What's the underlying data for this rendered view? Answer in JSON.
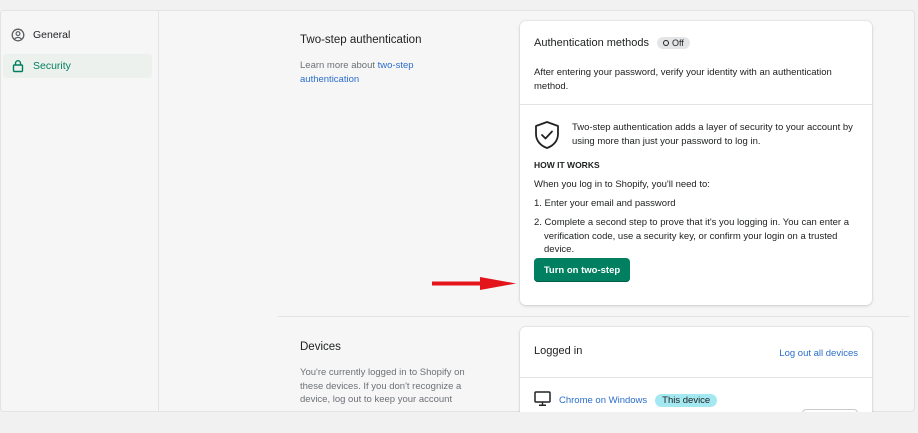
{
  "sidebar": {
    "items": [
      {
        "label": "General",
        "icon": "user-circle-icon"
      },
      {
        "label": "Security",
        "icon": "lock-icon"
      }
    ]
  },
  "two_step": {
    "title": "Two-step authentication",
    "desc_prefix": "Learn more about ",
    "desc_link": "two-step authentication"
  },
  "auth_card": {
    "title": "Authentication methods",
    "status_badge": "Off",
    "intro": "After entering your password, verify your identity with an authentication method.",
    "shield_text": "Two-step authentication adds a layer of security to your account by using more than just your password to log in.",
    "how_heading": "HOW IT WORKS",
    "how_intro": "When you log in to Shopify, you'll need to:",
    "step1": "1.  Enter your email and password",
    "step2": "2.  Complete a second step to prove that it's you logging in. You can enter a verification code, use a security key, or confirm your login on a trusted device.",
    "button": "Turn on two-step"
  },
  "devices": {
    "title": "Devices",
    "desc": "You're currently logged in to Shopify on these devices. If you don't recognize a device, log out to keep your account",
    "card_title": "Logged in",
    "logout_all": "Log out all devices",
    "device_name": "Chrome on Windows",
    "device_badge": "This device"
  },
  "colors": {
    "primary": "#008060",
    "link": "#2c6ecb",
    "arrow": "#e3151a"
  }
}
